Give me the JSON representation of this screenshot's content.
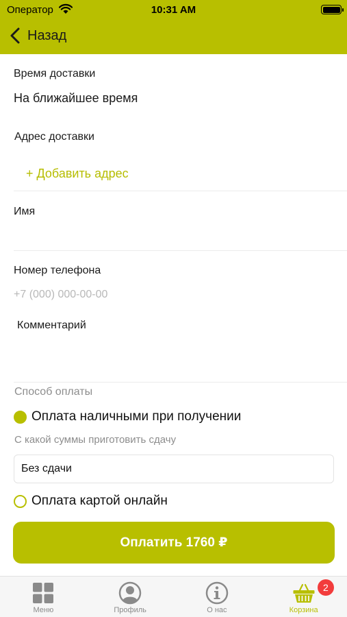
{
  "status_bar": {
    "carrier": "Оператор",
    "time": "10:31 AM"
  },
  "nav": {
    "back_label": "Назад"
  },
  "delivery_time": {
    "label": "Время доставки",
    "value": "На ближайшее время"
  },
  "address": {
    "label": "Адрес доставки",
    "add_link": "+ Добавить адрес"
  },
  "name": {
    "label": "Имя"
  },
  "phone": {
    "label": "Номер телефона",
    "placeholder": "+7 (000) 000-00-00"
  },
  "comment": {
    "label": "Комментарий"
  },
  "payment": {
    "label": "Способ оплаты",
    "cash_option": "Оплата наличными при получении",
    "change_label": "С какой суммы приготовить сдачу",
    "change_value": "Без сдачи",
    "card_option": "Оплата картой онлайн",
    "pay_button": "Оплатить 1760 ₽"
  },
  "tabs": [
    {
      "label": "Меню",
      "icon": "grid-icon"
    },
    {
      "label": "Профиль",
      "icon": "profile-icon"
    },
    {
      "label": "О нас",
      "icon": "info-icon"
    },
    {
      "label": "Корзина",
      "icon": "basket-icon",
      "badge": "2"
    }
  ],
  "colors": {
    "accent": "#b8bf00",
    "badge": "#f23c3c",
    "placeholder": "#b8b8b8"
  }
}
